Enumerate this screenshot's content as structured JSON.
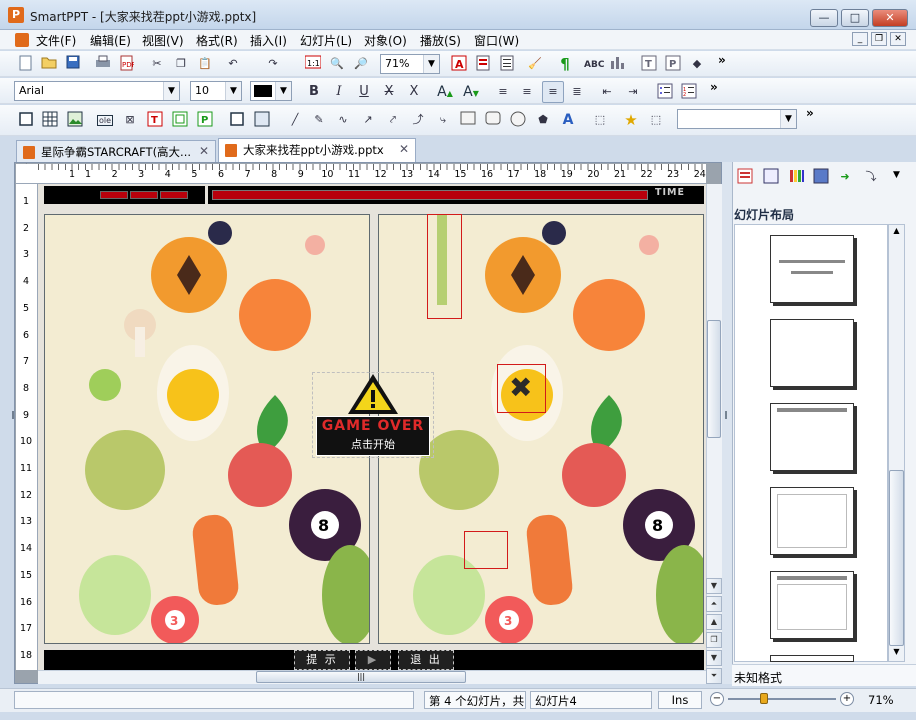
{
  "window": {
    "app_icon_letter": "P",
    "title": "SmartPPT - [大家来找茬ppt小游戏.pptx]",
    "minimize_glyph": "—",
    "maximize_glyph": "□",
    "close_glyph": "✕"
  },
  "menubar": {
    "items": [
      "文件(F)",
      "编辑(E)",
      "视图(V)",
      "格式(R)",
      "插入(I)",
      "幻灯片(L)",
      "对象(O)",
      "播放(S)",
      "窗口(W)"
    ],
    "mdi_minimize": "_",
    "mdi_restore": "❐",
    "mdi_close": "✕"
  },
  "toolbar1": {
    "zoom_value": "71%",
    "overflow": "»"
  },
  "toolbar2": {
    "font_name": "Arial",
    "font_size": "10",
    "bold": "B",
    "italic": "I",
    "underline": "U",
    "strike": "X",
    "double_strike": "X",
    "overflow": "»"
  },
  "toolbar3": {
    "style_combo_value": "",
    "overflow": "»"
  },
  "tabs": [
    {
      "label": "星际争霸STARCRAFT(高大..."
    },
    {
      "label": "大家来找茬ppt小游戏.pptx"
    }
  ],
  "ruler": {
    "h_numbers": [
      "1",
      "1",
      "2",
      "3",
      "4",
      "5",
      "6",
      "7",
      "8",
      "9",
      "10",
      "11",
      "12",
      "13",
      "14",
      "15",
      "16",
      "17",
      "18",
      "19",
      "20",
      "21",
      "22",
      "23",
      "24"
    ],
    "v_numbers": [
      "1",
      "2",
      "3",
      "4",
      "5",
      "6",
      "7",
      "8",
      "9",
      "10",
      "11",
      "12",
      "13",
      "14",
      "15",
      "16",
      "17",
      "18"
    ]
  },
  "slide": {
    "time_label": "TIME",
    "game_over_title": "GAME OVER",
    "game_over_sub": "点击开始",
    "hint_button": "提 示",
    "play_button": "▶",
    "exit_button": "退 出",
    "eight_ball": "8",
    "three_ball": "3"
  },
  "right_panel": {
    "title": "幻灯片布局",
    "footer": "未知格式"
  },
  "statusbar": {
    "slide_count": "第 4 个幻灯片，共",
    "slide_name": "幻灯片4",
    "ins": "Ins",
    "zoom": "71%"
  },
  "colors": {
    "accent": "#d21a1a",
    "title_gradient_top": "#dce8f5",
    "ppt_orange": "#e06a1b"
  }
}
